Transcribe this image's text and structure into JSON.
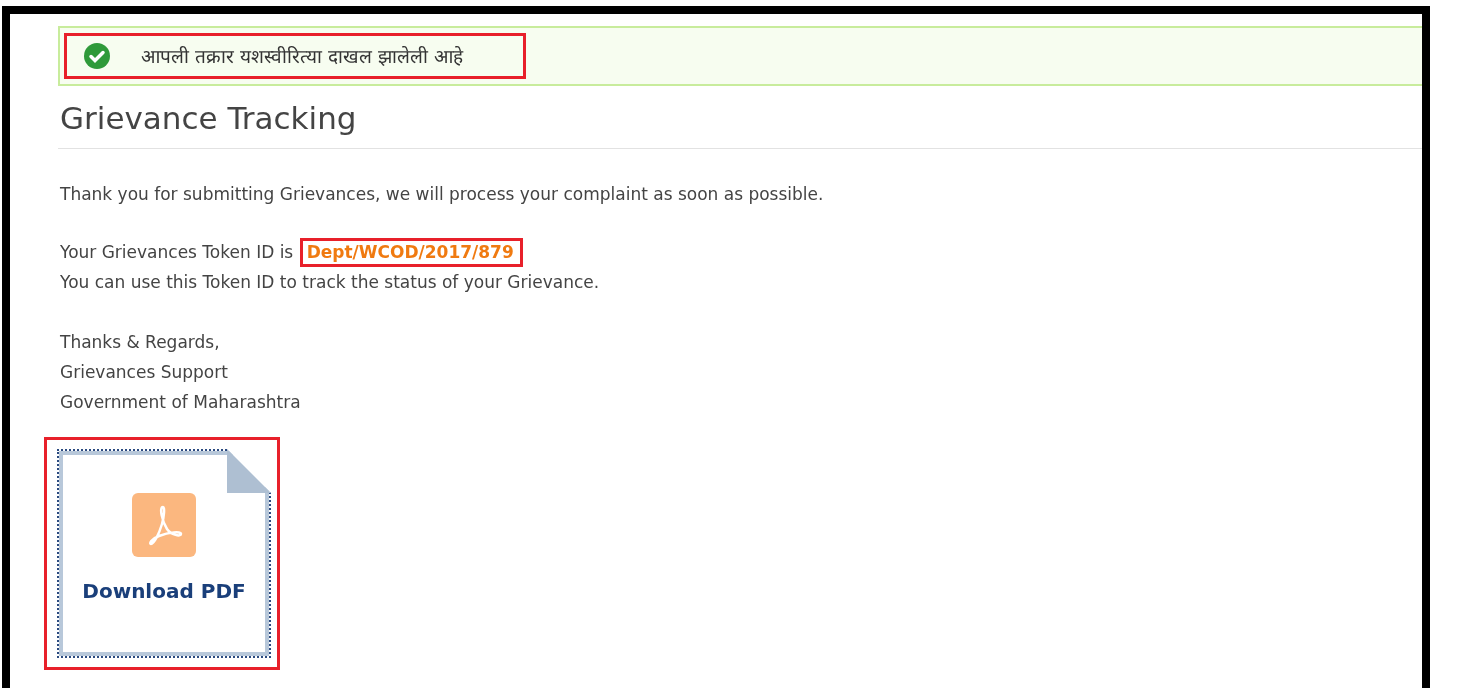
{
  "alert": {
    "kind": "success",
    "message": "आपली तक्रार यशस्वीरित्या दाखल झालेली आहे"
  },
  "title": "Grievance Tracking",
  "intro": "Thank you for submitting Grievances, we will process your complaint as soon as possible.",
  "token": {
    "label": "Your Grievances Token ID is",
    "value": "Dept/WCOD/2017/879"
  },
  "token_note": "You can use this Token ID to track the status of your Grievance.",
  "signature": [
    "Thanks & Regards,",
    "Grievances Support",
    "Government of Maharashtra"
  ],
  "download": {
    "label": "Download PDF"
  }
}
